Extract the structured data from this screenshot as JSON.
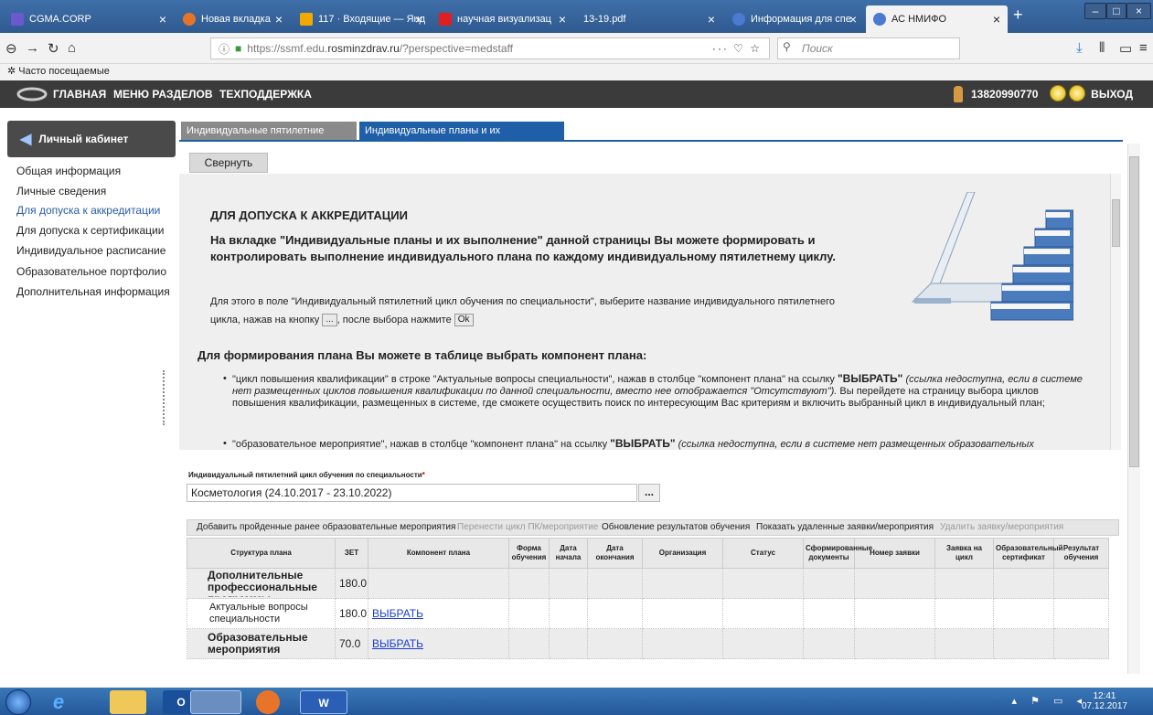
{
  "browser_tabs": [
    {
      "title": "CGMA.CORP",
      "color": "#6a5acd"
    },
    {
      "title": "Новая вкладка",
      "color": "#e8742a"
    },
    {
      "title": "117 · Входящие — Янд",
      "color": "#f2a900"
    },
    {
      "title": "научная визуализац",
      "color": "#e02020"
    },
    {
      "title": "13-19.pdf",
      "color": ""
    },
    {
      "title": "Информация для спе",
      "color": "#4a7bd0"
    },
    {
      "title": "АС НМИФО",
      "color": "#4a7bd0"
    }
  ],
  "url": {
    "prefix": "https://ssmf.edu.",
    "domain": "rosminzdrav.ru",
    "suffix": "/?perspective=medstaff"
  },
  "search_placeholder": "Поиск",
  "bookmarks_label": "Часто посещаемые",
  "site_header": {
    "home": "ГЛАВНАЯ",
    "menu": "МЕНЮ РАЗДЕЛОВ",
    "support": "ТЕХПОДДЕРЖКА",
    "user_id": "13820990770",
    "logout": "ВЫХОД"
  },
  "left": {
    "title": "Личный кабинет",
    "items": [
      "Общая информация",
      "Личные сведения",
      "Для допуска к аккредитации",
      "Для допуска к сертификации",
      "Индивидуальное расписание",
      "Образовательное портфолио",
      "Дополнительная информация"
    ]
  },
  "page_tabs": [
    "Индивидуальные пятилетние циклы",
    "Индивидуальные планы и их выполнение"
  ],
  "collapse_label": "Свернуть",
  "info": {
    "title": "ДЛЯ ДОПУСКА К АККРЕДИТАЦИИ",
    "lead": "На вкладке \"Индивидуальные планы и их выполнение\" данной страницы Вы можете формировать и контролировать выполнение индивидуального плана по каждому индивидуальному пятилетнему циклу.",
    "p1_a": "Для этого в поле \"Индивидуальный пятилетний цикл обучения по специальности\", выберите название индивидуального пятилетнего цикла, нажав на кнопку",
    "p1_btn": "...",
    "p1_b": ", после выбора нажмите",
    "p1_ok": "Ok",
    "subtitle": "Для формирования плана Вы можете в таблице выбрать компонент плана:",
    "b1_a": "\"цикл повышения квалификации\" в строке \"Актуальные вопросы специальности\", нажав в столбце \"компонент плана\" на ссылку",
    "b1_link": "\"ВЫБРАТЬ\"",
    "b1_em": "(ссылка недоступна, если в системе нет размещенных циклов повышения квалификации по данной специальности, вместо нее отображается \"Отсутствуют\").",
    "b1_b": "Вы перейдете на страницу выбора циклов повышения квалификации, размещенных в системе, где сможете осуществить поиск по интересующим Вас критериям и включить выбранный цикл в индивидуальный план;",
    "b2_a": "\"образовательное мероприятие\", нажав в столбце \"компонент плана\" на ссылку",
    "b2_link": "\"ВЫБРАТЬ\"",
    "b2_em": "(ссылка недоступна, если в системе нет размещенных образовательных"
  },
  "field": {
    "label": "Индивидуальный пятилетний цикл обучения по специальности",
    "required": "*",
    "value": "Косметология (24.10.2017 - 23.10.2022)",
    "button": "..."
  },
  "toolbar": [
    "Добавить пройденные ранее образовательные мероприятия",
    "Перенести цикл ПК/мероприятие",
    "Обновление результатов обучения",
    "Показать удаленные заявки/мероприятия",
    "Удалить заявку/мероприятия"
  ],
  "table": {
    "headers": [
      "Структура плана",
      "ЗЕТ",
      "Компонент плана",
      "Форма обучения",
      "Дата начала",
      "Дата окончания",
      "Организация",
      "Статус",
      "Сформированные документы",
      "Номер заявки",
      "Заявка на цикл",
      "Образовательный сертификат",
      "Результат обучения"
    ],
    "rows": [
      {
        "name": "Дополнительные профессиональные программы повышения",
        "zet": "180.0",
        "link": ""
      },
      {
        "name": "Актуальные вопросы специальности",
        "zet": "180.0",
        "link": "ВЫБРАТЬ"
      },
      {
        "name": "Образовательные мероприятия",
        "zet": "70.0",
        "link": "ВЫБРАТЬ"
      }
    ]
  },
  "clock": {
    "time": "12:41",
    "date": "07.12.2017"
  }
}
